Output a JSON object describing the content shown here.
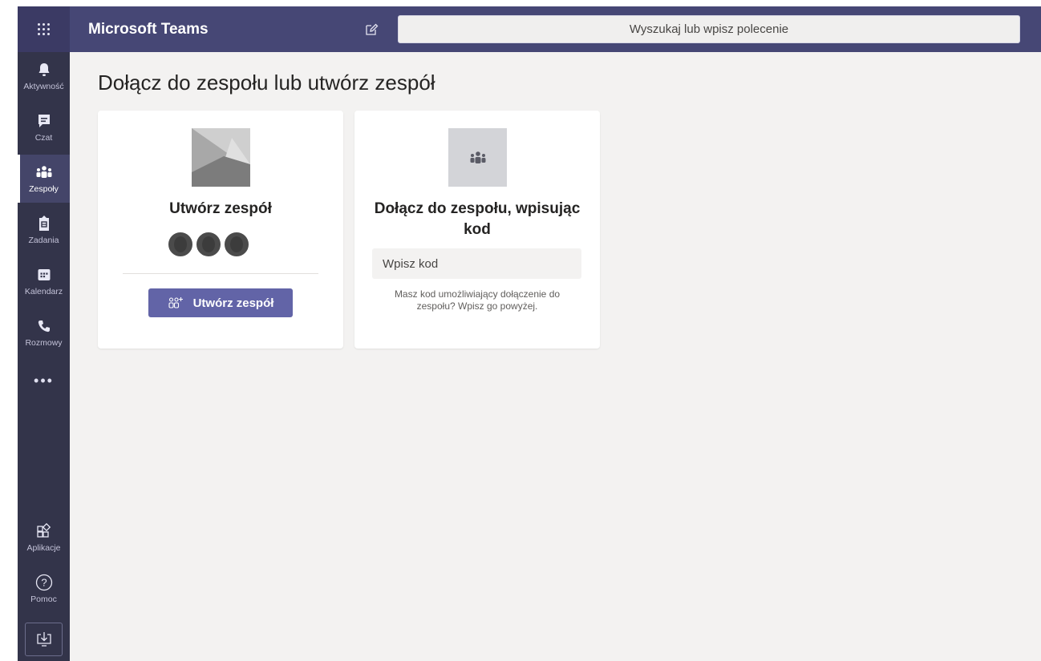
{
  "topbar": {
    "app_title": "Microsoft Teams",
    "search_placeholder": "Wyszukaj lub wpisz polecenie",
    "colors": {
      "bar": "#464775",
      "accent": "#6264a7"
    }
  },
  "rail": {
    "items": [
      {
        "label": "Aktywność",
        "icon": "bell-icon"
      },
      {
        "label": "Czat",
        "icon": "chat-icon"
      },
      {
        "label": "Zespoły",
        "icon": "teams-icon",
        "active": true
      },
      {
        "label": "Zadania",
        "icon": "assignments-icon"
      },
      {
        "label": "Kalendarz",
        "icon": "calendar-icon"
      },
      {
        "label": "Rozmowy",
        "icon": "phone-icon"
      }
    ],
    "more": "•••",
    "apps_label": "Aplikacje",
    "help_label": "Pomoc"
  },
  "main": {
    "title": "Dołącz do zespołu lub utwórz zespół",
    "create_card": {
      "title": "Utwórz zespół",
      "button_label": "Utwórz zespół"
    },
    "join_card": {
      "title": "Dołącz do zespołu, wpisując kod",
      "input_placeholder": "Wpisz kod",
      "hint": "Masz kod umożliwiający dołączenie do zespołu? Wpisz go powyżej."
    }
  }
}
